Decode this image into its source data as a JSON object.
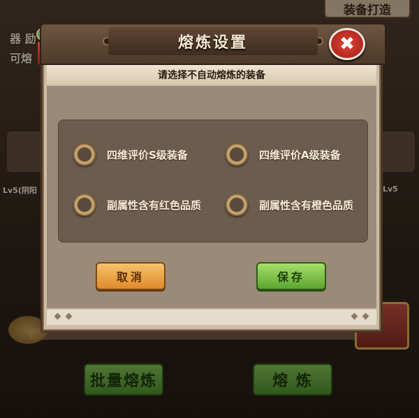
{
  "background": {
    "top_tab": "装备打造",
    "left_label_1": "器 励",
    "left_label_2": "可熔",
    "left_level": "Lv5(阴阳",
    "right_level": "Lv5",
    "bottom_left_button": "批量熔炼",
    "bottom_right_button": "熔 炼"
  },
  "dialog": {
    "title": "熔炼设置",
    "subtitle": "请选择不自动熔炼的装备",
    "close_icon": "✖",
    "options": [
      {
        "label": "四维评价S级装备",
        "checked": false
      },
      {
        "label": "四维评价A级装备",
        "checked": false
      },
      {
        "label": "副属性含有红色品质",
        "checked": false
      },
      {
        "label": "副属性含有橙色品质",
        "checked": false
      }
    ],
    "cancel_label": "取消",
    "save_label": "保存"
  },
  "colors": {
    "cancel": "#f0a840",
    "save": "#7cc446",
    "close": "#d0342a",
    "panel": "#6b5c4e"
  }
}
